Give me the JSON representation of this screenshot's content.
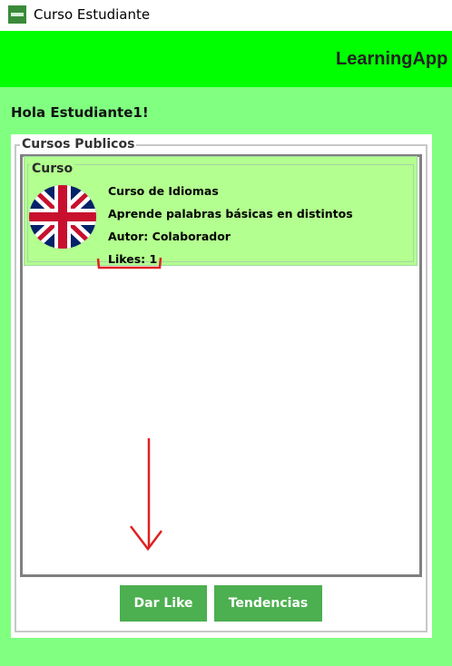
{
  "window": {
    "title": "Curso Estudiante"
  },
  "header": {
    "brand": "LearningApp"
  },
  "greeting": "Hola Estudiante1!",
  "courses_group": {
    "label": "Cursos Publicos",
    "items": [
      {
        "section_label": "Curso",
        "name": "Curso de Idiomas",
        "description": "Aprende palabras básicas en distintos",
        "author": "Autor: Colaborador",
        "likes": "Likes: 1"
      }
    ]
  },
  "buttons": {
    "like": "Dar Like",
    "trending": "Tendencias"
  },
  "colors": {
    "background": "#80ff80",
    "header": "#00ff00",
    "card": "#b3ff8f",
    "button": "#4caf50",
    "annotation": "#e02020"
  }
}
